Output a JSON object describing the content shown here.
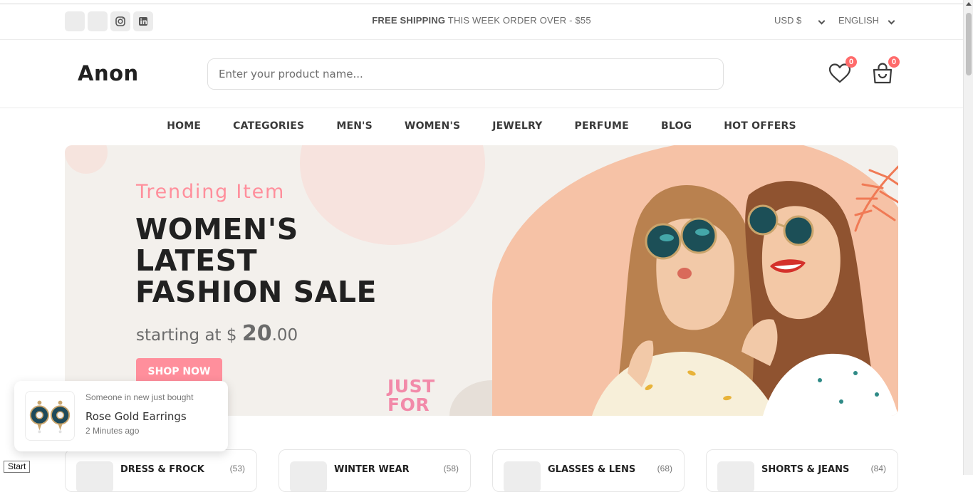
{
  "header_top": {
    "social": [
      "facebook-icon",
      "twitter-icon",
      "instagram-icon",
      "linkedin-icon"
    ],
    "shipping_bold": "FREE SHIPPING",
    "shipping_rest": " THIS WEEK ORDER OVER - $55",
    "currency": "USD $",
    "language": "ENGLISH"
  },
  "header_main": {
    "logo": "Anon",
    "search_placeholder": "Enter your product name...",
    "wishlist_count": "0",
    "cart_count": "0"
  },
  "nav": {
    "items": [
      "HOME",
      "CATEGORIES",
      "MEN'S",
      "WOMEN'S",
      "JEWELRY",
      "PERFUME",
      "BLOG",
      "HOT OFFERS"
    ]
  },
  "banner": {
    "subtitle": "Trending Item",
    "title_line1": "WOMEN'S",
    "title_line2": "LATEST",
    "title_line3": "FASHION SALE",
    "price_prefix": "starting at $ ",
    "price_big": "20",
    "price_cents": ".00",
    "cta": "SHOP NOW",
    "stamp_line1": "JUST",
    "stamp_line2": "FOR"
  },
  "toast": {
    "subtitle": "Someone in new just bought",
    "product": "Rose Gold Earrings",
    "time": "2 Minutes ago"
  },
  "categories": [
    {
      "name": "DRESS & FROCK",
      "count": "(53)"
    },
    {
      "name": "WINTER WEAR",
      "count": "(58)"
    },
    {
      "name": "GLASSES & LENS",
      "count": "(68)"
    },
    {
      "name": "SHORTS & JEANS",
      "count": "(84)"
    }
  ],
  "taskbar": {
    "start": "Start"
  },
  "colors": {
    "accent": "#ff8f9c",
    "badge": "#ff6b6b",
    "heading": "#212121",
    "banner_bg": "#f3f0ec",
    "peach": "#f6c2a6"
  }
}
